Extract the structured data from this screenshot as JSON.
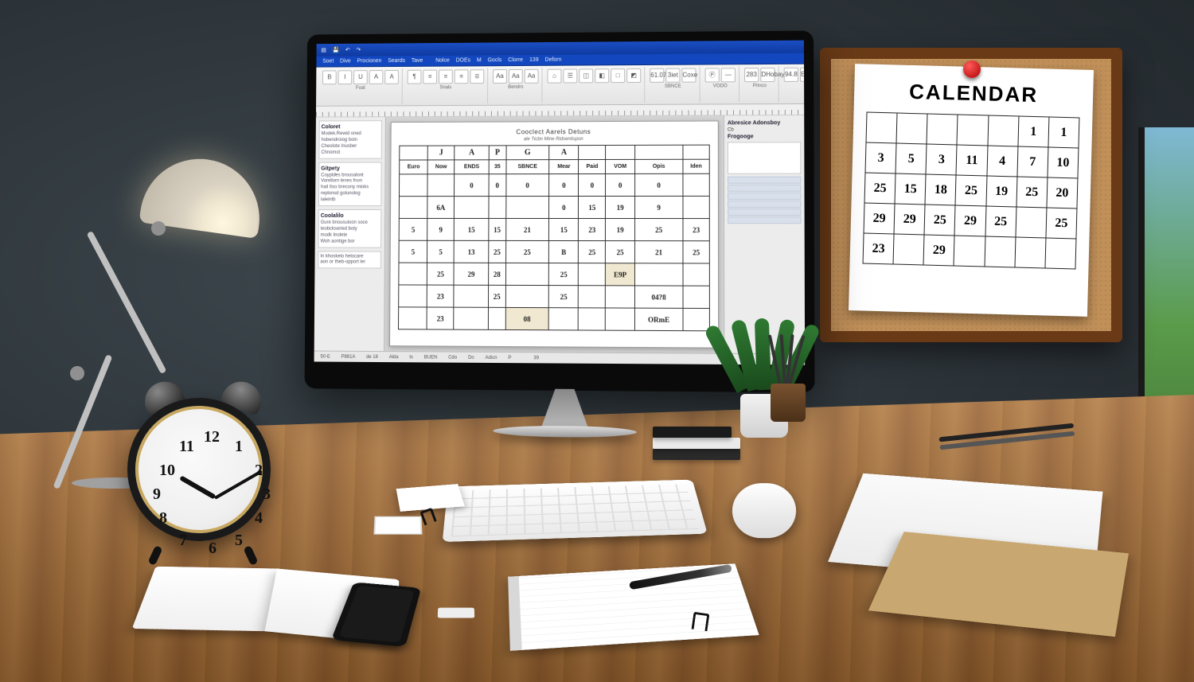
{
  "clock": {
    "numerals": {
      "n12": "12",
      "n1": "1",
      "n2": "2",
      "n3": "3",
      "n4": "4",
      "n5": "5",
      "n6": "6",
      "n7": "7",
      "n8": "8",
      "n9": "9",
      "n10": "10",
      "n11": "11"
    },
    "time_shown": "10:10"
  },
  "wall_calendar": {
    "title": "CALENDAR",
    "rows": [
      [
        "",
        "",
        "",
        "",
        "",
        "1",
        "1"
      ],
      [
        "3",
        "5",
        "3",
        "11",
        "4",
        "7",
        "10"
      ],
      [
        "25",
        "15",
        "18",
        "25",
        "19",
        "25",
        "20"
      ],
      [
        "29",
        "29",
        "25",
        "29",
        "25",
        "",
        "25"
      ],
      [
        "23",
        "",
        "29",
        "",
        "",
        "",
        ""
      ]
    ]
  },
  "app": {
    "title_left": "",
    "title_icons": [
      "app-icon",
      "save-icon",
      "undo-icon",
      "redo-icon"
    ],
    "menu": [
      "Soet",
      "Dive",
      "Procionen",
      "Seards",
      "Tave",
      "",
      "Nolce",
      "DOEs",
      "M",
      "Gocls",
      "Clorre",
      "139",
      "Deforn",
      "",
      "",
      "",
      ""
    ],
    "ribbon": {
      "groups": [
        {
          "label": "Foat",
          "buttons": [
            "B",
            "I",
            "U",
            "A",
            "A"
          ]
        },
        {
          "label": "Snals",
          "buttons": [
            "¶",
            "≡",
            "≡",
            "≡",
            "≣"
          ]
        },
        {
          "label": "Bendro",
          "buttons": [
            "Aa",
            "Aa",
            "Aa"
          ]
        },
        {
          "label": "",
          "buttons": [
            "⌂",
            "☰",
            "◫",
            "◧",
            "□",
            "◩"
          ]
        },
        {
          "label": "SBNCE",
          "buttons": [
            "61.07",
            "3iet",
            "Coxe"
          ]
        },
        {
          "label": "VODO",
          "buttons": [
            "Ⓟ",
            "—"
          ]
        },
        {
          "label": "Princo",
          "buttons": [
            "283",
            "DHobay"
          ]
        },
        {
          "label": "",
          "buttons": [
            "94.8",
            "Engare"
          ]
        },
        {
          "label": "",
          "buttons": [
            "☰",
            "☰",
            "☰"
          ]
        }
      ]
    },
    "left_panel": {
      "sections": [
        {
          "heading": "Coloret",
          "lines": [
            "Modek.Rewid oned",
            "hobendroiog boin",
            "Cheolote Inusber",
            "Chnomot"
          ]
        },
        {
          "heading": "Gitpety",
          "lines": [
            "Coypldes brousalont",
            "Vorellorn lenes fnon",
            "hail Itoo brecony mioks",
            "replonsd golunolog",
            "laleintb"
          ]
        },
        {
          "heading": "Coolalilo",
          "lines": [
            "Gure bnousuioon soce",
            "teobckseried boty",
            "modk Inolete",
            "Woh aontige bor"
          ]
        },
        {
          "heading": "",
          "lines": [
            "In khoskelo helocare",
            "aon or theb-opport ler"
          ]
        }
      ]
    },
    "document": {
      "title": "Cooclect Aarels Detuns",
      "subtitle": "ale Ticbn Mine Ridsentispon",
      "day_headers": [
        "",
        "J",
        "A",
        "P",
        "G",
        "A",
        "",
        "",
        ""
      ],
      "sub_headers": [
        "Euro",
        "Now",
        "ENDS",
        "35",
        "SBNCE",
        "Mear",
        "Paid",
        "VOM",
        "Opis",
        "Iden"
      ],
      "rows": [
        [
          "",
          "",
          "0",
          "0",
          "0",
          "0",
          "0",
          "0",
          "0",
          ""
        ],
        [
          "",
          "6A",
          "",
          "",
          "",
          "0",
          "15",
          "19",
          "9",
          ""
        ],
        [
          "5",
          "9",
          "15",
          "15",
          "21",
          "15",
          "23",
          "19",
          "25",
          "23"
        ],
        [
          "5",
          "5",
          "13",
          "25",
          "25",
          "B",
          "25",
          "25",
          "21",
          "25"
        ],
        [
          "",
          "25",
          "29",
          "28",
          "",
          "25",
          "",
          "E9P",
          "",
          ""
        ],
        [
          "",
          "23",
          "",
          "25",
          "",
          "25",
          "",
          "",
          "04?8",
          ""
        ],
        [
          "",
          "23",
          "",
          "",
          "08",
          "",
          "",
          "",
          "ORmE",
          ""
        ]
      ]
    },
    "right_panel": {
      "heading": "Abresice Adonsboy",
      "sub": "Cb",
      "label2": "Frogooge",
      "rows_count": 6
    },
    "status": [
      "50-E",
      "P881A",
      "de 18",
      "Alda",
      "ts",
      "BUEN",
      "Cdo",
      "Do",
      "Adicn",
      "P",
      "",
      "39"
    ]
  }
}
